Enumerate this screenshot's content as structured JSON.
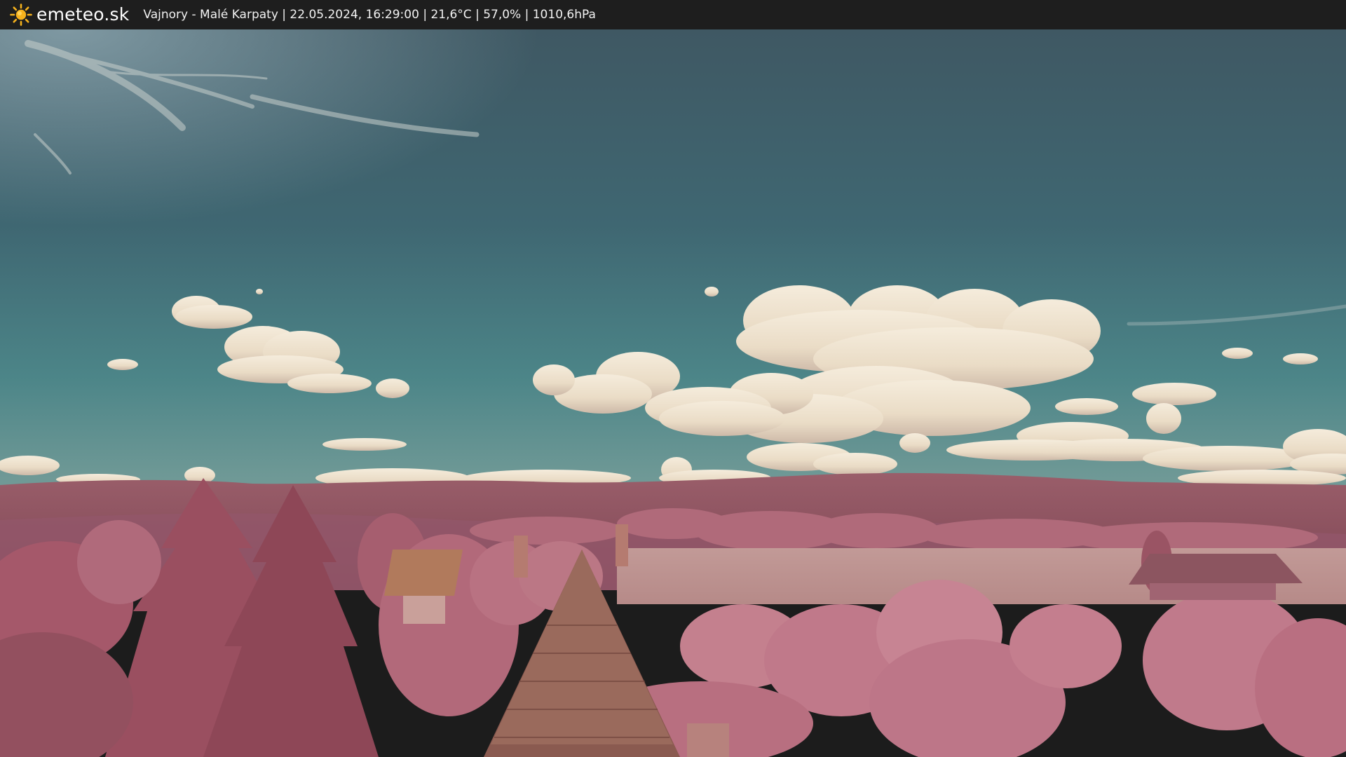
{
  "header": {
    "brand": "emeteo.sk",
    "logo_icon": "sun-icon",
    "info": "Vajnory - Malé Karpaty | 22.05.2024, 16:29:00 | 21,6°C | 57,0% | 1010,6hPa"
  },
  "colors": {
    "bar_background": "#1e1e1e",
    "sky_top": "#3e5560",
    "sky_bottom": "#6e9896",
    "cloud": "#efe3cf",
    "vegetation": "#b4707e",
    "hills": "#8e5462",
    "field": "#bd9492",
    "sun": "#f6b21c"
  }
}
